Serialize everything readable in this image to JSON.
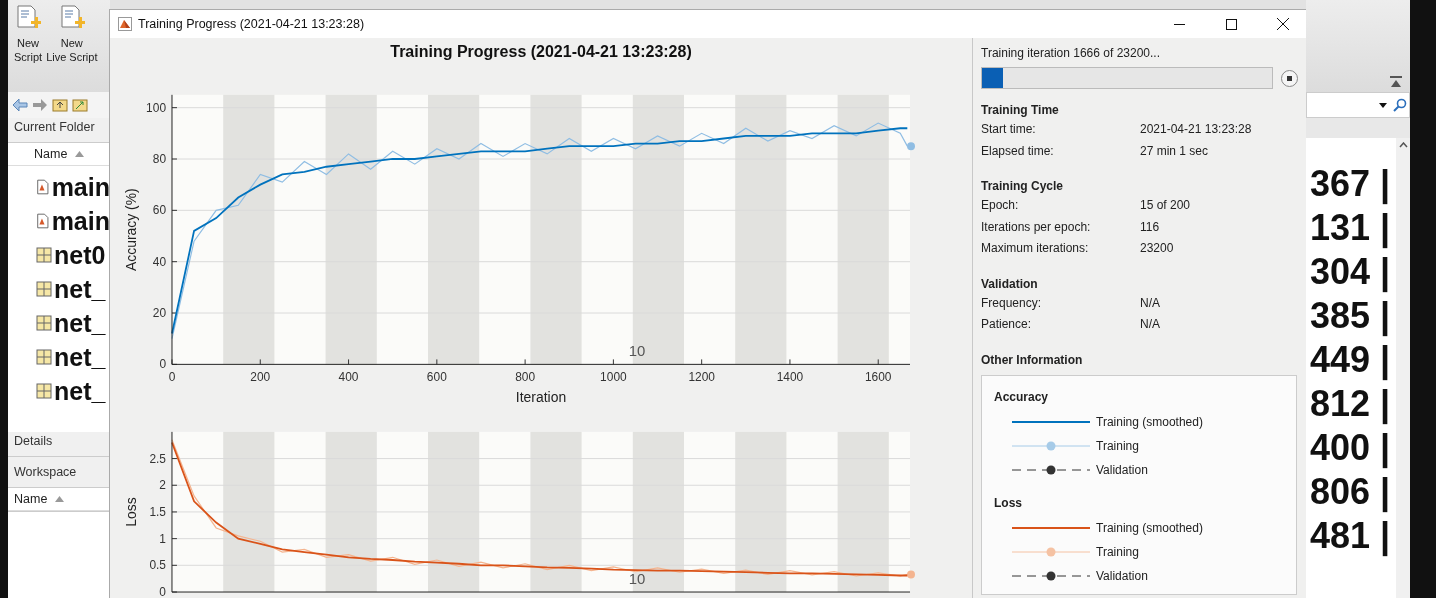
{
  "desktop": {
    "toolbar_buttons": [
      {
        "lines": [
          "New",
          "Script"
        ]
      },
      {
        "lines": [
          "New",
          "Live Script"
        ]
      }
    ],
    "current_folder": {
      "title": "Current Folder",
      "column": "Name",
      "files": [
        {
          "name": "main",
          "kind": "script"
        },
        {
          "name": "main",
          "kind": "script"
        },
        {
          "name": "net0",
          "kind": "data"
        },
        {
          "name": "net_",
          "kind": "data"
        },
        {
          "name": "net_",
          "kind": "data"
        },
        {
          "name": "net_",
          "kind": "data"
        },
        {
          "name": "net_",
          "kind": "data"
        }
      ]
    },
    "details": {
      "title": "Details"
    },
    "workspace": {
      "title": "Workspace",
      "column": "Name"
    },
    "command_window_lines": [
      "367 |",
      "131 |",
      "304 |",
      "385 |",
      "449 |",
      "812 |",
      "400 |",
      "806 |",
      "481 |"
    ]
  },
  "window": {
    "title": "Training Progress (2021-04-21 13:23:28)",
    "plot_title": "Training Progress (2021-04-21 13:23:28)",
    "accuracy_plot": {
      "chart_data": {
        "type": "line",
        "xlabel": "Iteration",
        "ylabel": "Accuracy (%)",
        "xlim": [
          0,
          1672
        ],
        "ylim": [
          0,
          105
        ],
        "xticks": [
          0,
          200,
          400,
          600,
          800,
          1000,
          1200,
          1400,
          1600
        ],
        "yticks": [
          0,
          20,
          40,
          60,
          80,
          100
        ],
        "x": [
          0,
          50,
          100,
          150,
          200,
          250,
          300,
          350,
          400,
          450,
          500,
          550,
          600,
          650,
          700,
          750,
          800,
          850,
          900,
          950,
          1000,
          1050,
          1100,
          1150,
          1200,
          1250,
          1300,
          1350,
          1400,
          1450,
          1500,
          1550,
          1600,
          1650,
          1666
        ],
        "series": [
          {
            "color": "#8fbde3",
            "values": [
              10,
              48,
              60,
              62,
              74,
              71,
              79,
              74,
              82,
              76,
              83,
              78,
              84,
              80,
              86,
              81,
              86,
              82,
              88,
              83,
              88,
              84,
              89,
              85,
              90,
              86,
              92,
              87,
              91,
              88,
              93,
              89,
              94,
              90,
              85
            ]
          },
          {
            "color": "#0072bd",
            "values": [
              12,
              52,
              57,
              65,
              70,
              74,
              75,
              77,
              78,
              79,
              80,
              80,
              81,
              82,
              83,
              83,
              83,
              84,
              85,
              85,
              85,
              86,
              86,
              87,
              87,
              88,
              89,
              89,
              89,
              90,
              90,
              90,
              91,
              92,
              92
            ]
          }
        ],
        "grid": true,
        "bands": [
          {
            "axis": "x",
            "from": 116,
            "to": 232
          },
          {
            "axis": "x",
            "from": 348,
            "to": 464
          },
          {
            "axis": "x",
            "from": 580,
            "to": 696
          },
          {
            "axis": "x",
            "from": 812,
            "to": 928
          },
          {
            "axis": "x",
            "from": 1044,
            "to": 1160
          },
          {
            "axis": "x",
            "from": 1276,
            "to": 1392
          },
          {
            "axis": "x",
            "from": 1508,
            "to": 1624
          }
        ],
        "annotations": [
          "10"
        ]
      }
    },
    "loss_plot": {
      "chart_data": {
        "type": "line",
        "ylabel": "Loss",
        "xlim": [
          0,
          1672
        ],
        "ylim": [
          0,
          3
        ],
        "yticks": [
          0,
          0.5,
          1,
          1.5,
          2,
          2.5
        ],
        "x": [
          0,
          50,
          100,
          150,
          200,
          250,
          300,
          350,
          400,
          450,
          500,
          550,
          600,
          650,
          700,
          750,
          800,
          850,
          900,
          950,
          1000,
          1050,
          1100,
          1150,
          1200,
          1250,
          1300,
          1350,
          1400,
          1450,
          1500,
          1550,
          1600,
          1650,
          1666
        ],
        "series": [
          {
            "color": "#f4b48f",
            "values": [
              2.85,
              1.8,
              1.2,
              1.05,
              0.95,
              0.75,
              0.8,
              0.65,
              0.7,
              0.58,
              0.65,
              0.52,
              0.6,
              0.48,
              0.56,
              0.45,
              0.53,
              0.42,
              0.5,
              0.4,
              0.47,
              0.38,
              0.45,
              0.37,
              0.43,
              0.35,
              0.41,
              0.33,
              0.4,
              0.32,
              0.38,
              0.3,
              0.36,
              0.3,
              0.33
            ]
          },
          {
            "color": "#d95319",
            "values": [
              2.8,
              1.7,
              1.3,
              1.0,
              0.9,
              0.8,
              0.75,
              0.7,
              0.65,
              0.62,
              0.6,
              0.57,
              0.55,
              0.53,
              0.5,
              0.5,
              0.48,
              0.46,
              0.45,
              0.44,
              0.42,
              0.41,
              0.4,
              0.4,
              0.39,
              0.38,
              0.37,
              0.36,
              0.35,
              0.35,
              0.34,
              0.33,
              0.32,
              0.31,
              0.31
            ]
          }
        ],
        "grid": true,
        "bands": [
          {
            "axis": "x",
            "from": 116,
            "to": 232
          },
          {
            "axis": "x",
            "from": 348,
            "to": 464
          },
          {
            "axis": "x",
            "from": 580,
            "to": 696
          },
          {
            "axis": "x",
            "from": 812,
            "to": 928
          },
          {
            "axis": "x",
            "from": 1044,
            "to": 1160
          },
          {
            "axis": "x",
            "from": 1276,
            "to": 1392
          },
          {
            "axis": "x",
            "from": 1508,
            "to": 1624
          }
        ],
        "annotations": [
          "10"
        ]
      }
    },
    "status": "Training iteration 1666 of 23200...",
    "progress": {
      "level": 0.072
    },
    "sections": [
      {
        "title": "Training Time",
        "rows": [
          {
            "label": "Start time:",
            "value": "2021-04-21 13:23:28"
          },
          {
            "label": "Elapsed time:",
            "value": "27 min 1 sec"
          }
        ]
      },
      {
        "title": "Training Cycle",
        "rows": [
          {
            "label": "Epoch:",
            "value": "15 of 200"
          },
          {
            "label": "Iterations per epoch:",
            "value": "116"
          },
          {
            "label": "Maximum iterations:",
            "value": "23200"
          }
        ]
      },
      {
        "title": "Validation",
        "rows": [
          {
            "label": "Frequency:",
            "value": "N/A"
          },
          {
            "label": "Patience:",
            "value": "N/A"
          }
        ]
      },
      {
        "title": "Other Information"
      }
    ],
    "legend": [
      {
        "title": "Accuracy",
        "entries": [
          {
            "label": "Training (smoothed)",
            "kind": "line",
            "color": "#0072bd"
          },
          {
            "label": "Training",
            "kind": "marker",
            "color": "#a6cbe8"
          },
          {
            "label": "Validation",
            "kind": "dashed",
            "color": "#333333"
          }
        ]
      },
      {
        "title": "Loss",
        "entries": [
          {
            "label": "Training (smoothed)",
            "kind": "line",
            "color": "#d95319"
          },
          {
            "label": "Training",
            "kind": "marker",
            "color": "#f5c2a3"
          },
          {
            "label": "Validation",
            "kind": "dashed",
            "color": "#333333"
          }
        ]
      }
    ]
  }
}
